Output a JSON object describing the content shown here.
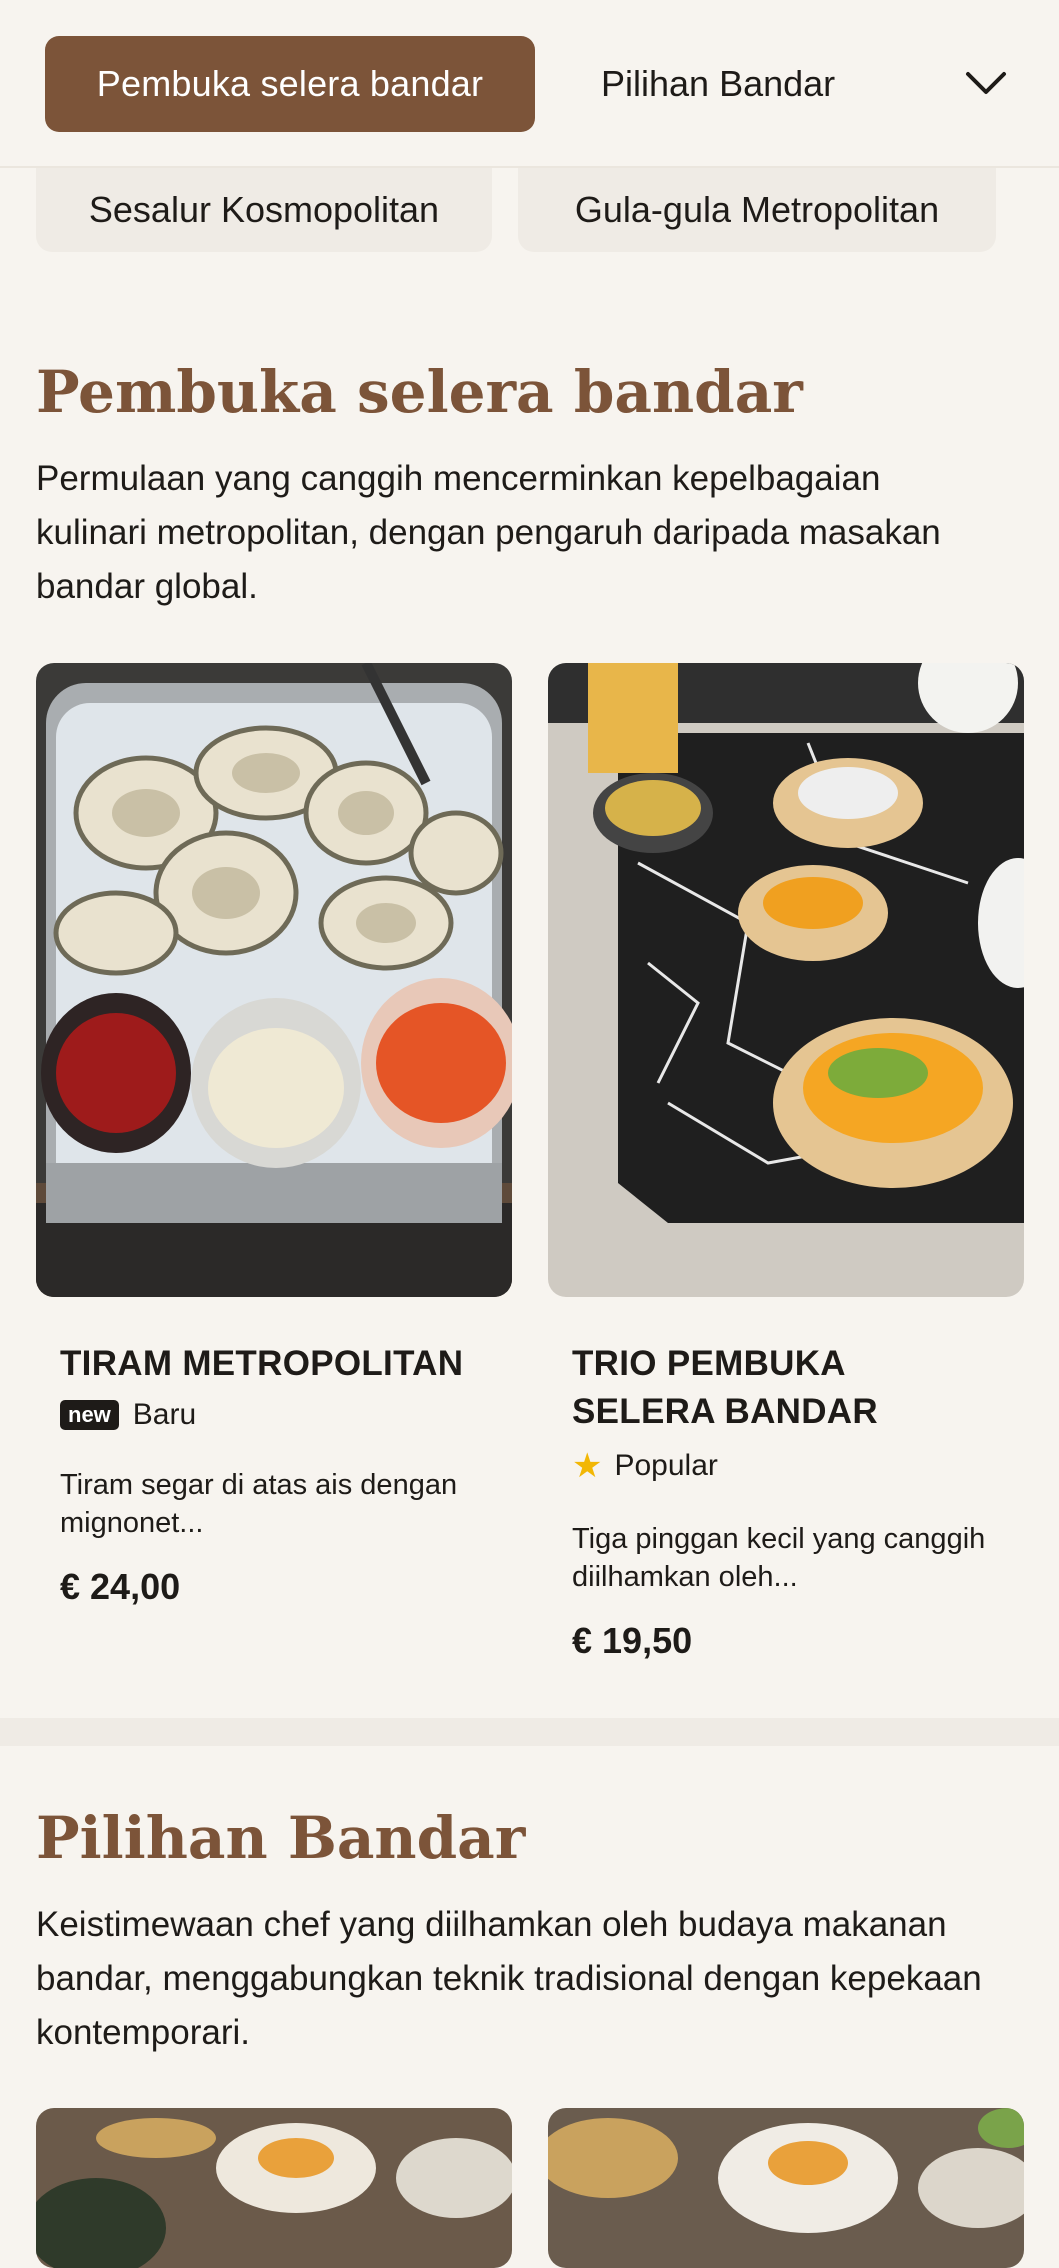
{
  "nav": {
    "active_category": "Pembuka selera bandar",
    "next_category": "Pilihan Bandar",
    "more_categories": [
      "Sesalur Kosmopolitan",
      "Gula-gula Metropolitan"
    ]
  },
  "sections": [
    {
      "title": "Pembuka selera bandar",
      "description": "Permulaan yang canggih mencerminkan kepelbagaian kulinari metropolitan, dengan pengaruh daripada masakan bandar global.",
      "items": [
        {
          "name": "TIRAM METROPOLITAN",
          "badge_icon": "new",
          "badge_label": "Baru",
          "description": "Tiram segar di atas ais dengan mignonet...",
          "price": "€ 24,00"
        },
        {
          "name": "TRIO PEMBUKA SELERA BANDAR",
          "badge_icon": "star-icon",
          "badge_label": "Popular",
          "description": "Tiga pinggan kecil yang canggih diilhamkan oleh...",
          "price": "€ 19,50"
        }
      ]
    },
    {
      "title": "Pilihan Bandar",
      "description": "Keistimewaan chef yang diilhamkan oleh budaya makanan bandar, menggabungkan teknik tradisional dengan kepekaan kontemporari."
    }
  ],
  "colors": {
    "accent": "#7c5439",
    "background": "#f7f4ef",
    "star": "#f2b705"
  }
}
